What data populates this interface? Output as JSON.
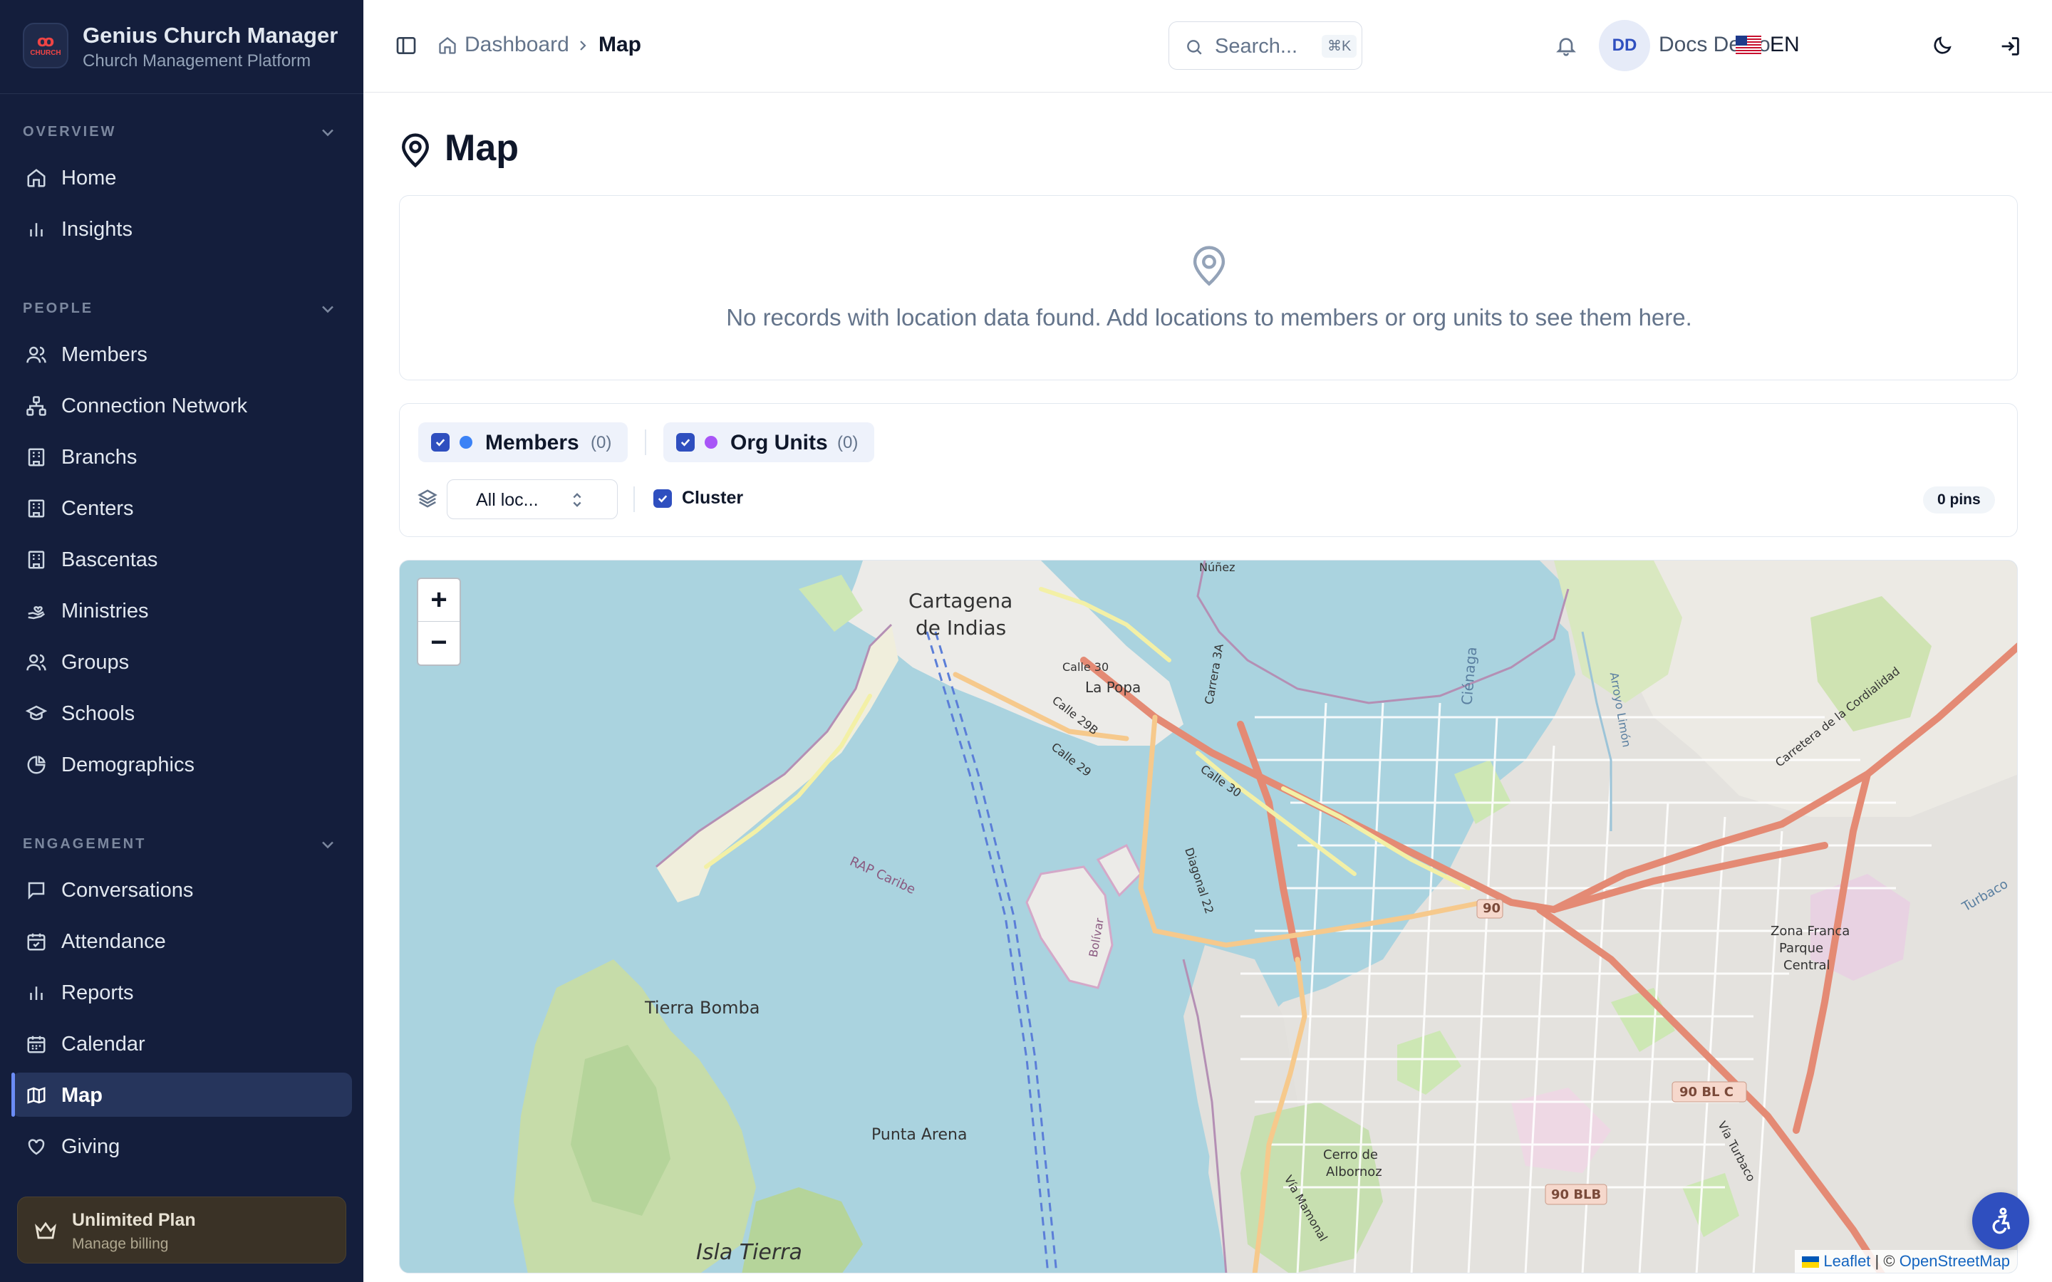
{
  "app": {
    "title": "Genius Church Manager",
    "subtitle": "Church Management Platform",
    "logo_ring": "ꝏ",
    "logo_text": "CHURCH"
  },
  "sidebar": {
    "sections": [
      {
        "label": "OVERVIEW",
        "items": [
          {
            "label": "Home",
            "icon": "home-icon"
          },
          {
            "label": "Insights",
            "icon": "bar-chart-icon"
          }
        ]
      },
      {
        "label": "PEOPLE",
        "items": [
          {
            "label": "Members",
            "icon": "users-icon"
          },
          {
            "label": "Connection Network",
            "icon": "network-icon"
          },
          {
            "label": "Branchs",
            "icon": "building-icon"
          },
          {
            "label": "Centers",
            "icon": "building-icon"
          },
          {
            "label": "Bascentas",
            "icon": "building-icon"
          },
          {
            "label": "Ministries",
            "icon": "hand-heart-icon"
          },
          {
            "label": "Groups",
            "icon": "users-icon"
          },
          {
            "label": "Schools",
            "icon": "graduation-cap-icon"
          },
          {
            "label": "Demographics",
            "icon": "pie-chart-icon"
          }
        ]
      },
      {
        "label": "ENGAGEMENT",
        "items": [
          {
            "label": "Conversations",
            "icon": "chat-icon"
          },
          {
            "label": "Attendance",
            "icon": "calendar-check-icon"
          },
          {
            "label": "Reports",
            "icon": "bar-chart-icon"
          },
          {
            "label": "Calendar",
            "icon": "calendar-icon"
          },
          {
            "label": "Map",
            "icon": "map-icon",
            "active": true
          },
          {
            "label": "Giving",
            "icon": "heart-icon"
          }
        ]
      }
    ],
    "plan": {
      "title": "Unlimited Plan",
      "subtitle": "Manage billing",
      "icon": "crown-icon"
    }
  },
  "header": {
    "breadcrumb": [
      "Dashboard",
      "Map"
    ],
    "search_placeholder": "Search...",
    "search_shortcut": "⌘K",
    "user_initials": "DD",
    "user_name": "Docs Demo",
    "language": "EN",
    "flag": "🇺🇸"
  },
  "page": {
    "title": "Map",
    "empty_message": "No records with location data found. Add locations to members or org units to see them here."
  },
  "filters": {
    "layers": [
      {
        "label": "Members",
        "count": "(0)",
        "color": "#3b82f6",
        "checked": true
      },
      {
        "label": "Org Units",
        "count": "(0)",
        "color": "#a855f7",
        "checked": true
      }
    ],
    "location_select": "All loc...",
    "cluster_label": "Cluster",
    "cluster_checked": true,
    "pins_count": "0 pins"
  },
  "map": {
    "zoom_in": "+",
    "zoom_out": "−",
    "labels": {
      "city": "Cartagena",
      "city2": "de Indias",
      "tierra_bomba": "Tierra Bomba",
      "punta_arena": "Punta Arena",
      "isla": "Isla Tierra",
      "la_popa": "La Popa",
      "zona_franca": "Zona Franca",
      "parque": "Parque",
      "central": "Central",
      "cerro": "Cerro de",
      "albornoz": "Albornoz",
      "turbaco": "Turbaco",
      "calle30": "Calle 30",
      "calle30b": "Calle 30",
      "calle29": "Calle 29",
      "calle29b": "Calle 29B",
      "rap": "RAP Caribe",
      "bolivar": "Bolívar",
      "diagonal": "Diagonal 22",
      "mamonal": "Vía Mamonal",
      "cordialidad": "Carretera de la Cordialidad",
      "via_turbaco": "Vía Turbaco",
      "carrera": "Carrera 3A",
      "nunez": "Núñez",
      "arroyo": "Arroyo Limón",
      "r90": "90",
      "r90blc": "90 BL C",
      "r90blb": "90 BLB",
      "cgena": "Ciénaga"
    },
    "attribution_leaflet": "Leaflet",
    "attribution_sep": " | © ",
    "attribution_osm": "OpenStreetMap",
    "colors": {
      "water": "#aad3df",
      "land": "#f2efe9",
      "urban": "#e0dfdf",
      "green": "#cde7b4",
      "forest": "#add19e",
      "primary_road": "#f2917a",
      "secondary_road": "#fcd6a4",
      "tertiary": "#f7fabf"
    }
  },
  "accessibility_button": {
    "icon": "accessibility-icon"
  }
}
